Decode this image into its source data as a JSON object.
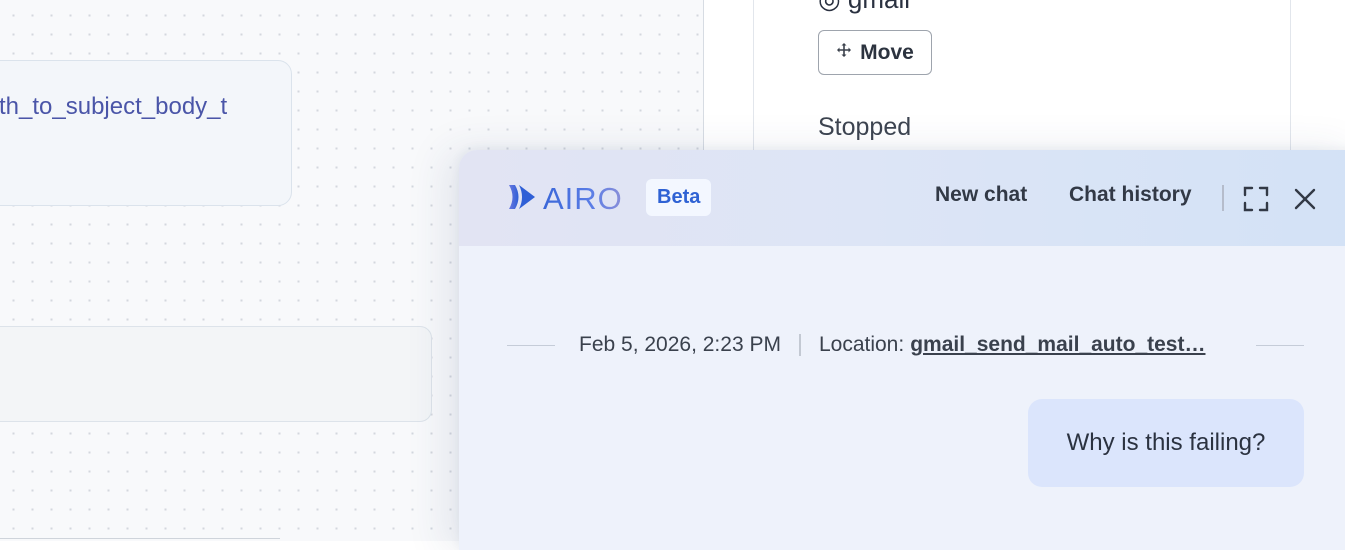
{
  "canvas": {
    "node_top_text": "th_to_subject_body_t"
  },
  "side_panel": {
    "prev_label": "◎ gmail",
    "move_label": "Move",
    "status": "Stopped"
  },
  "chat": {
    "brand": "AIRO",
    "beta_label": "Beta",
    "header": {
      "new_chat": "New chat",
      "chat_history": "Chat history"
    },
    "meta": {
      "datetime": "Feb 5, 2026, 2:23 PM",
      "location_label": "Location:",
      "location_value": "gmail_send_mail_auto_test…"
    },
    "messages": [
      {
        "role": "user",
        "text": "Why is this failing?"
      }
    ]
  },
  "icons": {
    "brand": "airo-logo-icon",
    "move": "move-arrows-icon",
    "expand": "expand-icon",
    "close": "close-icon"
  },
  "colors": {
    "brand_blue": "#2f62d4",
    "node_text": "#4a55a8",
    "user_bubble": "#dbe5fc"
  }
}
